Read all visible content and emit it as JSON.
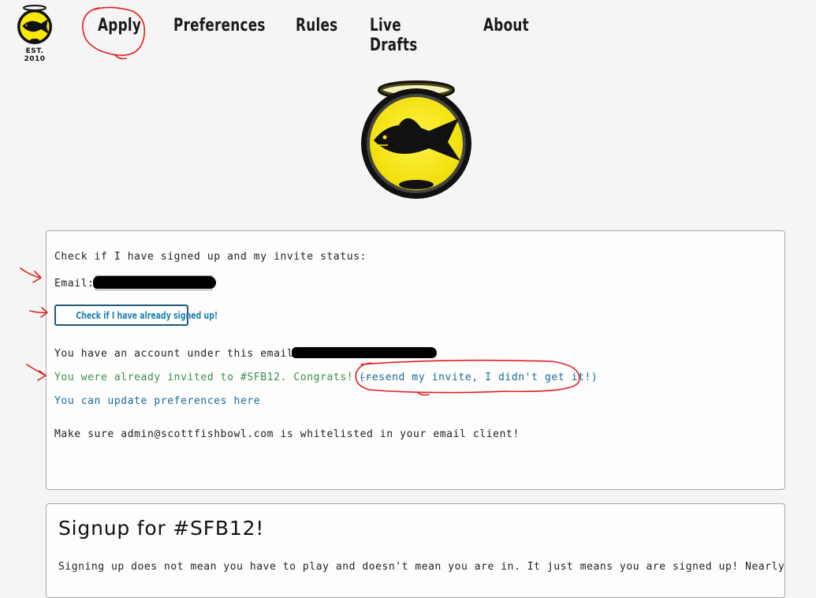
{
  "header": {
    "established": "EST. 2010",
    "nav": [
      "Apply",
      "Preferences",
      "Rules",
      "Live Drafts",
      "About"
    ]
  },
  "status_panel": {
    "heading": "Check if I have signed up and my invite status:",
    "email_label": "Email:",
    "check_button": "Check if I have already signed up!",
    "account_text": "You have an account under this email:",
    "invited_text": "You were already invited to #SFB12. Congrats! --",
    "resend_link": "(resend my invite, I didn't get it!)",
    "preferences_link": "You can update preferences here",
    "whitelist_text": "Make sure admin@scottfishbowl.com is whitelisted in your email client!"
  },
  "signup_panel": {
    "title": "Signup for #SFB12!",
    "body": "Signing up does not mean you have to play and doesn't mean you are in. It just means you are signed up! Nearly"
  },
  "colors": {
    "page_bg": "#f5f5f5",
    "logo_yellow": "#f7e80b",
    "link_blue": "#1a6a9a",
    "success_green": "#3b8f47",
    "button_text": "#1d7fb0",
    "annotation_red": "#e02020"
  }
}
